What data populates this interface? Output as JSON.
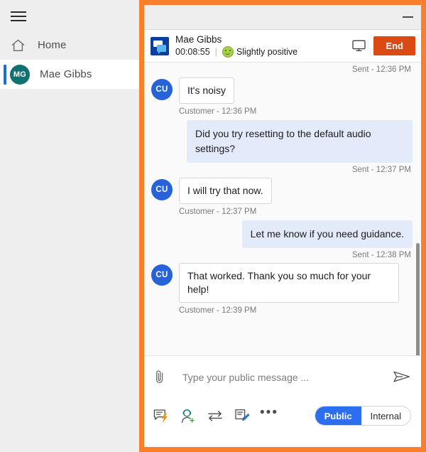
{
  "sidebar": {
    "menu_icon": "hamburger-icon",
    "items": [
      {
        "label": "Home",
        "icon": "home-icon"
      },
      {
        "label": "Mae Gibbs",
        "avatar_initials": "MG",
        "avatar_color": "#117070",
        "selected": true
      }
    ]
  },
  "window": {
    "minimize_label": "",
    "minimize_icon": "minimize-icon"
  },
  "conversation_header": {
    "channel_icon": "chat-bubbles-icon",
    "customer_name": "Mae Gibbs",
    "duration": "00:08:55",
    "separator": "|",
    "sentiment_icon": "smiley-face-icon",
    "sentiment": "Slightly positive",
    "sentiment_color": "#a8d14a",
    "monitor_icon": "monitor-icon",
    "end_label": "End",
    "end_color": "#da4a12"
  },
  "transcript": {
    "customer_avatar_initials": "CU",
    "customer_avatar_color": "#2663d9",
    "entries": [
      {
        "kind": "sent-stamp",
        "text": "Sent - 12:36 PM"
      },
      {
        "kind": "customer",
        "text": "It's noisy",
        "stamp": "Customer - 12:36 PM"
      },
      {
        "kind": "agent",
        "text": "Did you try resetting to the default audio settings?",
        "stamp": "Sent - 12:37 PM"
      },
      {
        "kind": "customer",
        "text": "I will try that now.",
        "stamp": "Customer - 12:37 PM"
      },
      {
        "kind": "agent",
        "text": "Let me know if you need guidance.",
        "stamp": "Sent - 12:38 PM"
      },
      {
        "kind": "customer",
        "text": "That worked. Thank you so much for your help!",
        "stamp": "Customer - 12:39 PM"
      }
    ]
  },
  "composer": {
    "attach_icon": "paperclip-icon",
    "placeholder": "Type your public message ...",
    "value": "",
    "send_icon": "send-paper-plane-icon"
  },
  "actionbar": {
    "icons": [
      {
        "name": "quick-reply-icon"
      },
      {
        "name": "add-agent-icon"
      },
      {
        "name": "transfer-icon"
      },
      {
        "name": "note-icon"
      }
    ],
    "more_label": "•••",
    "visibility": {
      "public_label": "Public",
      "internal_label": "Internal",
      "selected": "Public",
      "active_color": "#2b6ff0"
    }
  }
}
